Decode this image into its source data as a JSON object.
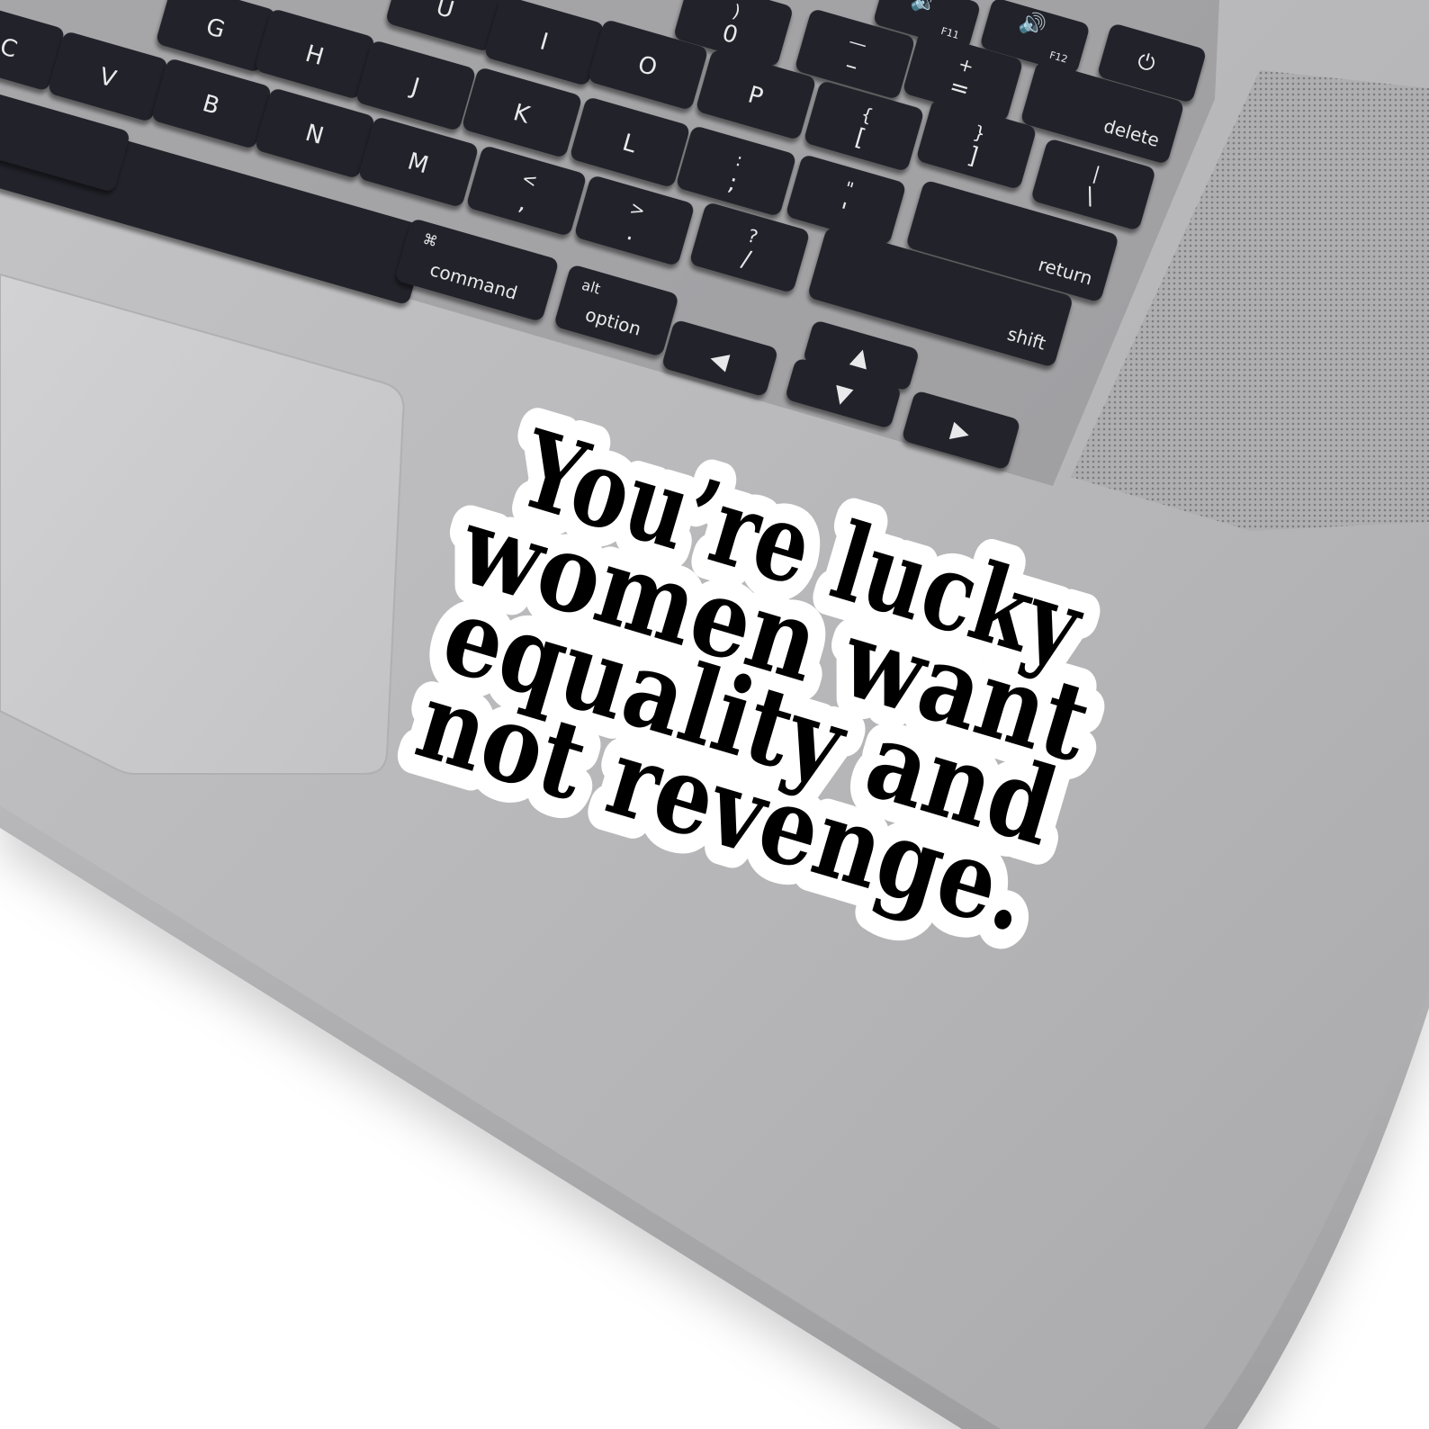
{
  "colors": {
    "background": "#ffffff",
    "laptop_body": "#b3b3b5",
    "keyboard_well": "#8f8f92",
    "key": "#23242a",
    "key_text": "#e9e9ec",
    "trackpad": "#c9c9cb",
    "sticker_text": "#000000",
    "sticker_border": "#ffffff"
  },
  "keyboard": {
    "keys": [
      {
        "name": "key-u",
        "label": "U"
      },
      {
        "name": "key-0",
        "label": "0",
        "sub": ")"
      },
      {
        "name": "key-f11",
        "label": "F11",
        "icon": "speaker-icon"
      },
      {
        "name": "key-f12",
        "label": "F12",
        "icon": "speaker-loud-icon"
      },
      {
        "name": "key-power",
        "label": "",
        "icon": "power-icon"
      },
      {
        "name": "key-g",
        "label": "G"
      },
      {
        "name": "key-i",
        "label": "I"
      },
      {
        "name": "key-minus",
        "label": "–",
        "sub": "—"
      },
      {
        "name": "key-c",
        "label": "C"
      },
      {
        "name": "key-h",
        "label": "H"
      },
      {
        "name": "key-o",
        "label": "O"
      },
      {
        "name": "key-equals",
        "label": "=",
        "sub": "+"
      },
      {
        "name": "key-v",
        "label": "V"
      },
      {
        "name": "key-j",
        "label": "J"
      },
      {
        "name": "key-p",
        "label": "P"
      },
      {
        "name": "key-delete",
        "label": "delete"
      },
      {
        "name": "key-b",
        "label": "B"
      },
      {
        "name": "key-k",
        "label": "K"
      },
      {
        "name": "key-bracket-left",
        "label": "[",
        "sub": "{"
      },
      {
        "name": "key-bracket-right",
        "label": "]",
        "sub": "}"
      },
      {
        "name": "key-n",
        "label": "N"
      },
      {
        "name": "key-l",
        "label": "L"
      },
      {
        "name": "key-backslash",
        "label": "\\",
        "sub": "|"
      },
      {
        "name": "key-m",
        "label": "M"
      },
      {
        "name": "key-semicolon",
        "label": ";",
        "sub": ":"
      },
      {
        "name": "key-quote",
        "label": "'",
        "sub": "\""
      },
      {
        "name": "key-comma",
        "label": ",",
        "sub": "<"
      },
      {
        "name": "key-period",
        "label": ".",
        "sub": ">"
      },
      {
        "name": "key-return",
        "label": "return"
      },
      {
        "name": "key-command",
        "label": "command",
        "sub": "⌘"
      },
      {
        "name": "key-slash",
        "label": "/",
        "sub": "?"
      },
      {
        "name": "key-shift",
        "label": "shift"
      },
      {
        "name": "key-option",
        "label": "option",
        "sub": "alt"
      },
      {
        "name": "key-arrow-left",
        "label": "◀"
      },
      {
        "name": "key-arrow-up",
        "label": "▲"
      },
      {
        "name": "key-arrow-down",
        "label": "▼"
      },
      {
        "name": "key-arrow-right",
        "label": "▶"
      }
    ]
  },
  "sticker": {
    "lines": [
      "You’re lucky",
      "women want",
      "equality and",
      "not revenge."
    ]
  }
}
